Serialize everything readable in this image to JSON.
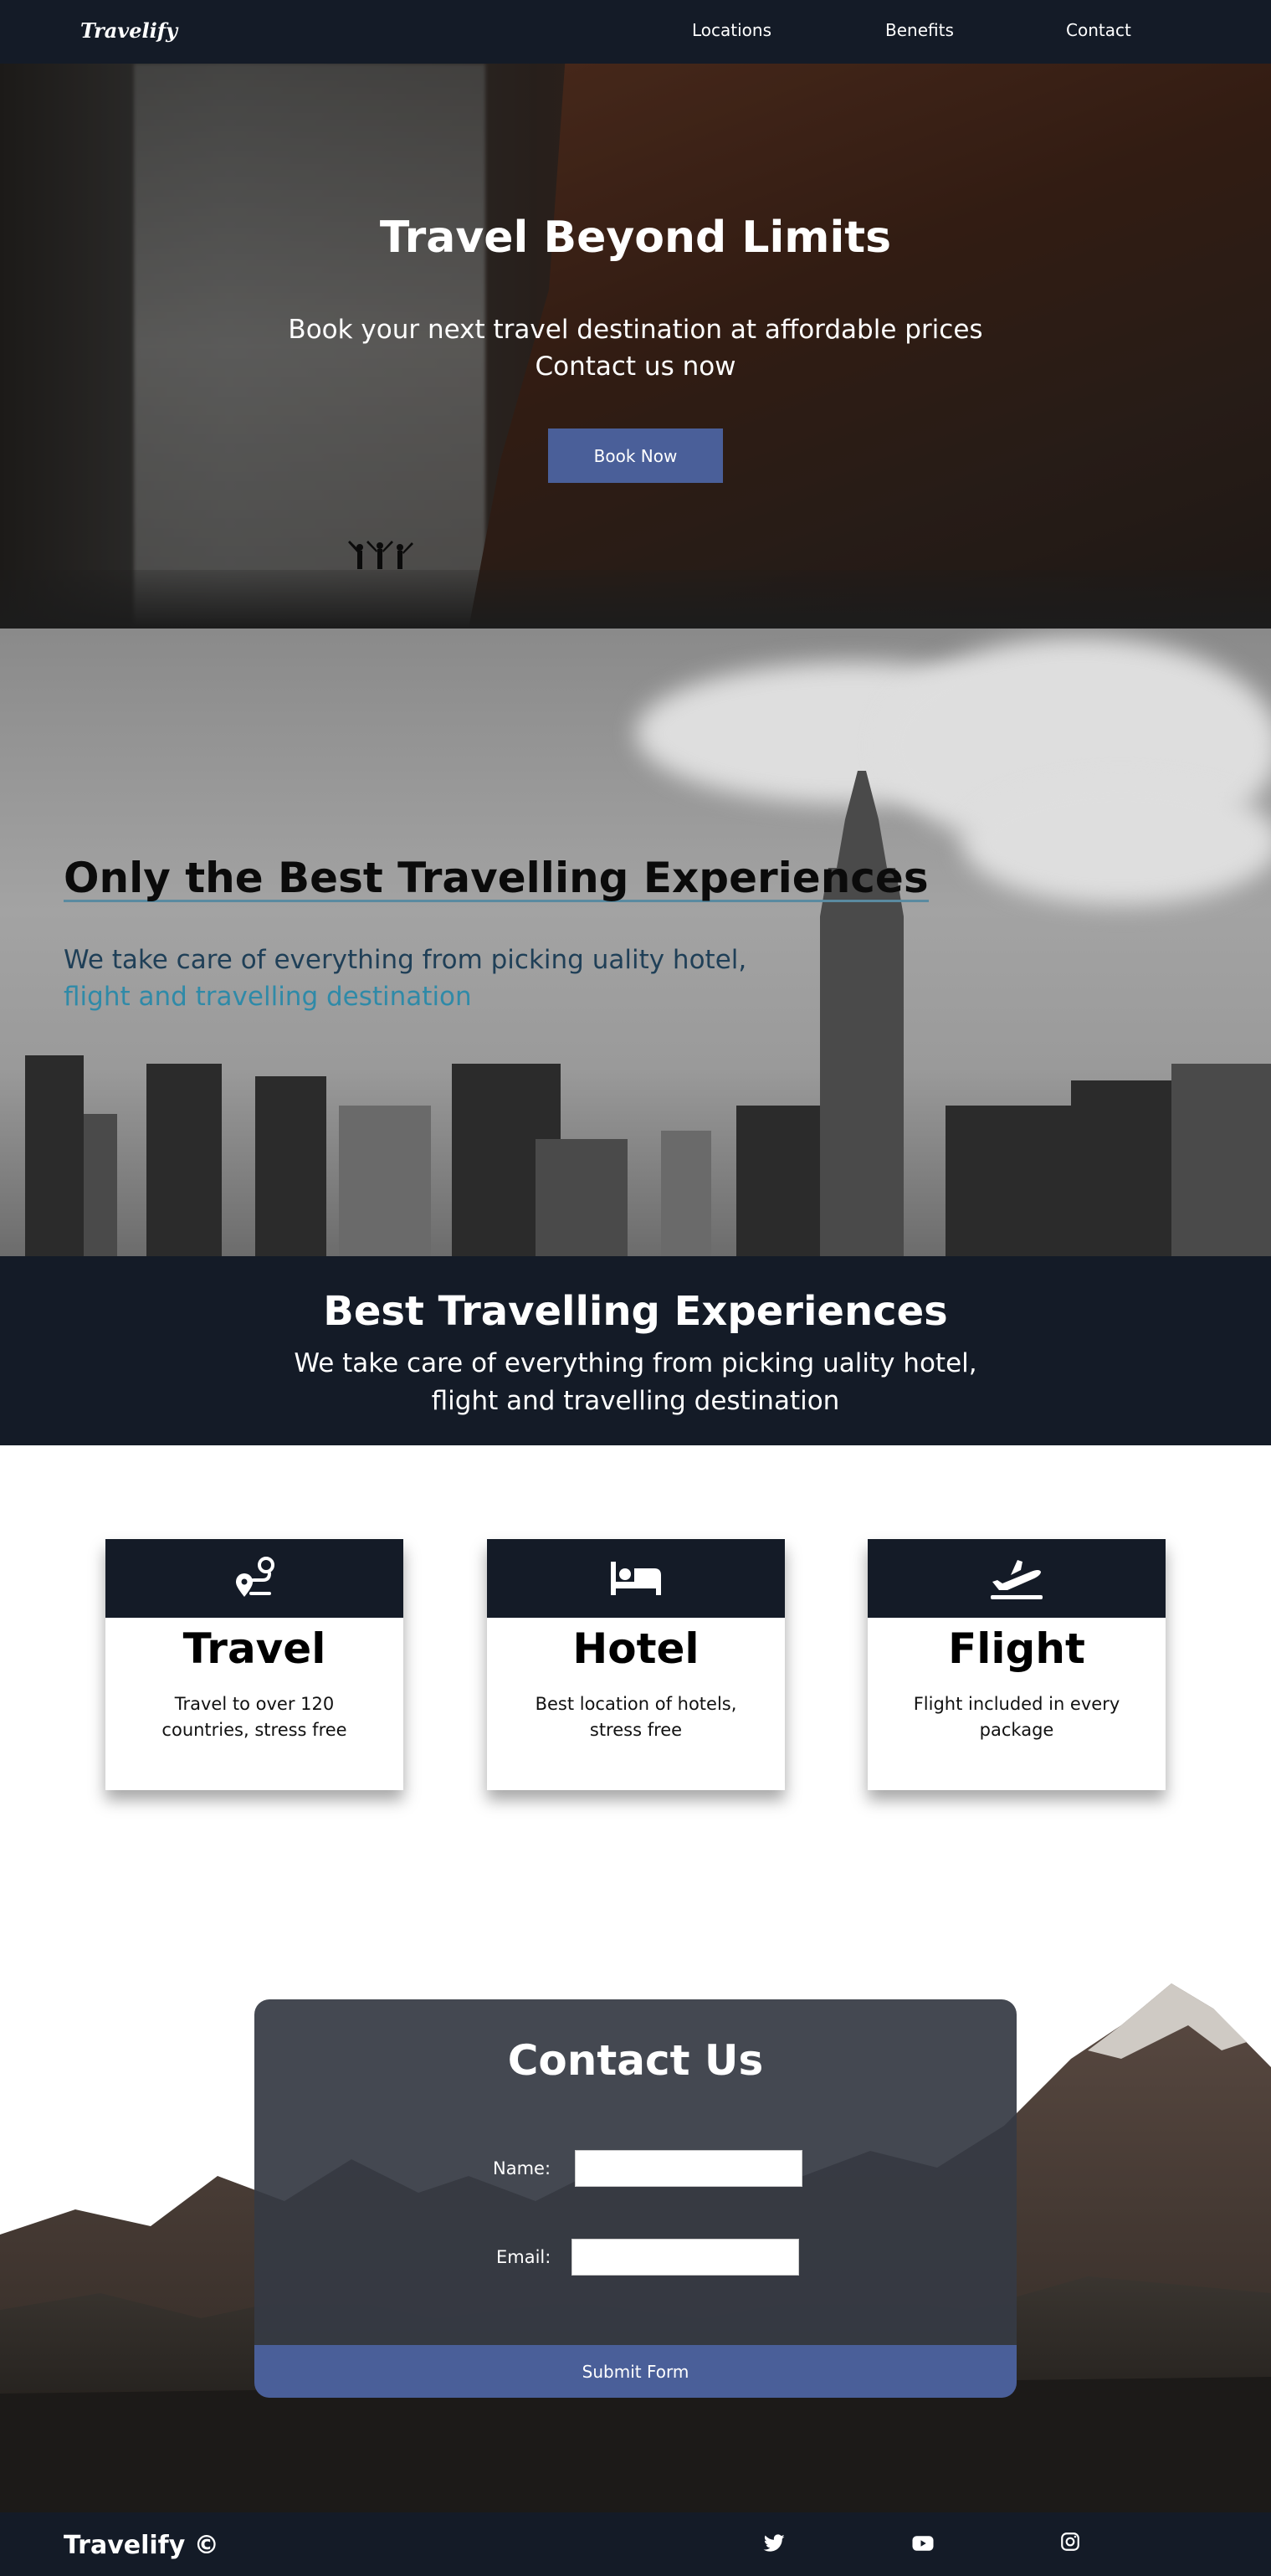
{
  "nav": {
    "brand": "Travelify",
    "links": [
      "Locations",
      "Benefits",
      "Contact"
    ]
  },
  "hero": {
    "title": "Travel Beyond Limits",
    "subtitle_line1": "Book your next travel destination at affordable prices",
    "subtitle_line2": "Contact us now",
    "button": "Book Now"
  },
  "experiences": {
    "title": "Only the Best Travelling Experiences",
    "line1": "We take care of everything from picking uality hotel,",
    "line2": "flight and travelling destination"
  },
  "band": {
    "title": "Best Travelling Experiences",
    "line1": "We take care of everything from picking uality hotel,",
    "line2": "flight and travelling destination"
  },
  "cards": [
    {
      "icon": "route-icon",
      "title": "Travel",
      "desc": "Travel to over 120 countries, stress free"
    },
    {
      "icon": "bed-icon",
      "title": "Hotel",
      "desc": "Best location of hotels, stress free"
    },
    {
      "icon": "plane-departure-icon",
      "title": "Flight",
      "desc": "Flight included in every package"
    }
  ],
  "contact": {
    "title": "Contact Us",
    "name_label": "Name:",
    "email_label": "Email:",
    "submit": "Submit Form"
  },
  "footer": {
    "brand": "Travelify ©",
    "social": [
      "twitter-icon",
      "youtube-icon",
      "instagram-icon"
    ]
  },
  "colors": {
    "dark": "#141b27",
    "accent": "#4a5f99",
    "teal": "#2f8aa8"
  }
}
